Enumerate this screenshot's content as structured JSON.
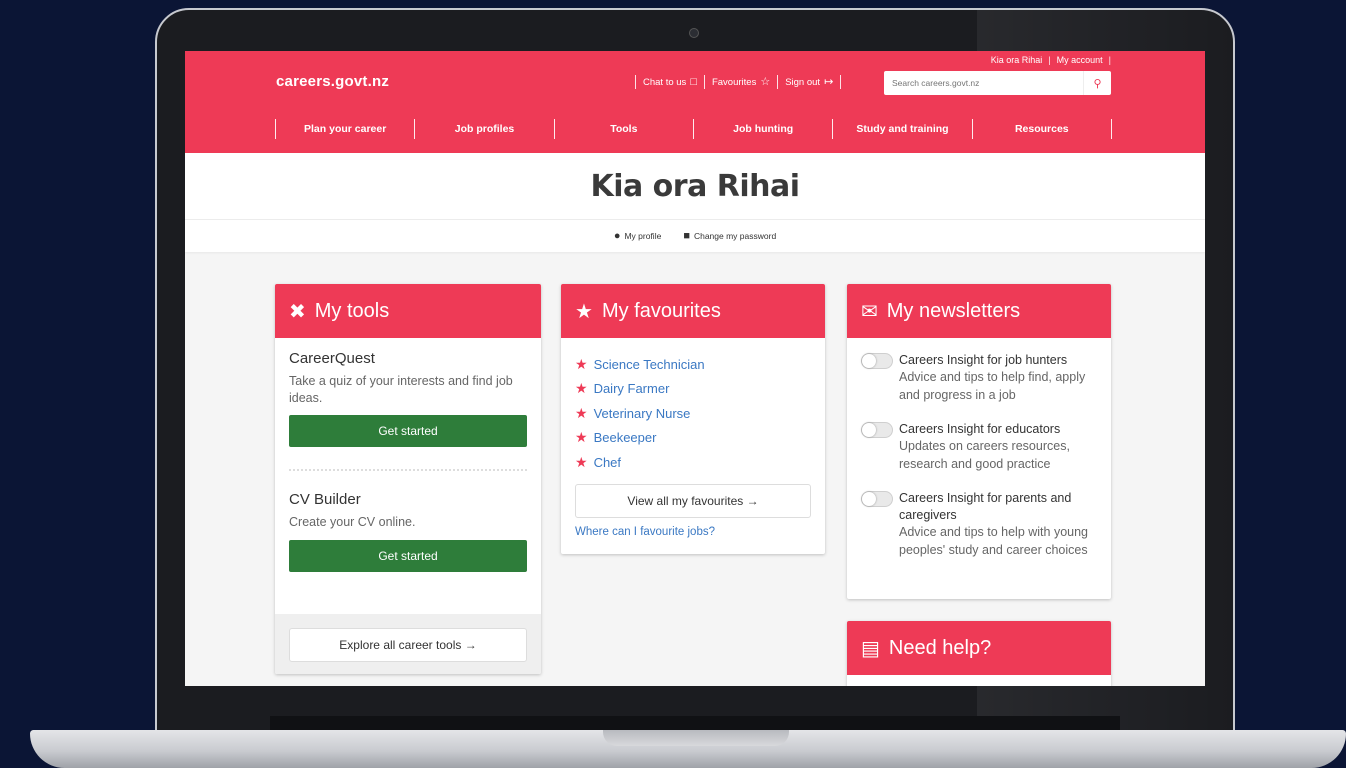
{
  "site": {
    "logo": "careers.govt.nz"
  },
  "account": {
    "greeting": "Kia ora Rihai",
    "my_account": "My account",
    "sep": "|"
  },
  "utils": {
    "chat": "Chat to us",
    "favourites": "Favourites",
    "signout": "Sign out"
  },
  "search": {
    "placeholder": "Search careers.govt.nz"
  },
  "nav": {
    "items": [
      "Plan your career",
      "Job profiles",
      "Tools",
      "Job hunting",
      "Study and training",
      "Resources"
    ]
  },
  "page": {
    "title": "Kia ora Rihai"
  },
  "subnav": {
    "profile": "My profile",
    "password": "Change my password"
  },
  "tools": {
    "title": "My tools",
    "items": [
      {
        "name": "CareerQuest",
        "desc": "Take a quiz of your interests and find job ideas.",
        "button": "Get started"
      },
      {
        "name": "CV Builder",
        "desc": "Create your CV online.",
        "button": "Get started"
      }
    ],
    "explore": "Explore all career tools →"
  },
  "favourites": {
    "title": "My favourites",
    "items": [
      "Science Technician",
      "Dairy Farmer",
      "Veterinary Nurse",
      "Beekeeper",
      "Chef"
    ],
    "view_all": "View all my favourites →",
    "help_link": "Where can I favourite jobs?"
  },
  "newsletters": {
    "title": "My newsletters",
    "items": [
      {
        "title": "Careers Insight for job hunters",
        "desc": "Advice and tips to help find, apply and progress in a job"
      },
      {
        "title": "Careers Insight for educators",
        "desc": "Updates on careers resources, research and good practice"
      },
      {
        "title": "Careers Insight for parents and caregivers",
        "desc": "Advice and tips to help with young peoples' study and career choices"
      }
    ]
  },
  "help": {
    "title": "Need help?"
  },
  "colors": {
    "brand": "#ee3a56",
    "button_green": "#2e7d3a",
    "link": "#3a78c3"
  },
  "icons": {
    "chat": "chat-icon",
    "favourites": "star-outline-icon",
    "signout": "sign-out-icon",
    "search": "search-icon",
    "tools": "tools-icon",
    "favs": "star-icon",
    "news": "envelope-icon",
    "help": "chat-bubble-icon",
    "profile": "user-icon",
    "password": "lock-icon"
  }
}
